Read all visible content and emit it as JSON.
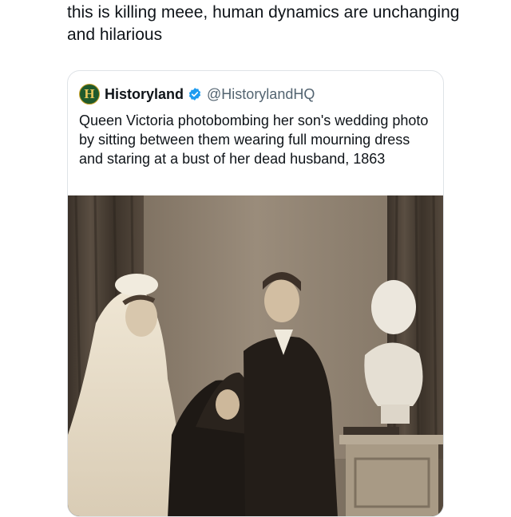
{
  "post": {
    "text": "this is killing meee, human dynamics are unchanging and hilarious"
  },
  "quoted_tweet": {
    "avatar_letter": "H",
    "display_name": "Historyland",
    "verified_icon": "verified-badge-icon",
    "handle": "@HistorylandHQ",
    "text": "Queen Victoria photobombing her son's wedding photo by sitting between them wearing full mourning dress and staring at a bust of her dead husband, 1863",
    "image": "sepia-wedding-photo"
  },
  "colors": {
    "verified": "#1d9bf0",
    "handle": "#536471",
    "card_border": "#dfe3e7",
    "avatar_bg": "#1f5a2c"
  }
}
